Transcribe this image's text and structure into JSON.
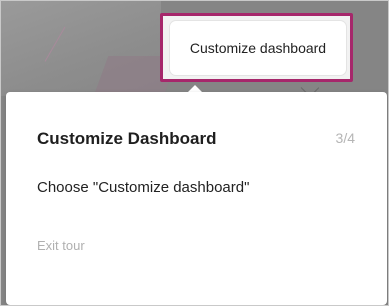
{
  "target": {
    "label": "Customize dashboard"
  },
  "tour": {
    "title": "Customize Dashboard",
    "step": "3/4",
    "instruction": "Choose \"Customize dashboard\"",
    "exit_label": "Exit tour"
  },
  "colors": {
    "highlight_border": "#a6276b",
    "overlay": "#858585"
  }
}
